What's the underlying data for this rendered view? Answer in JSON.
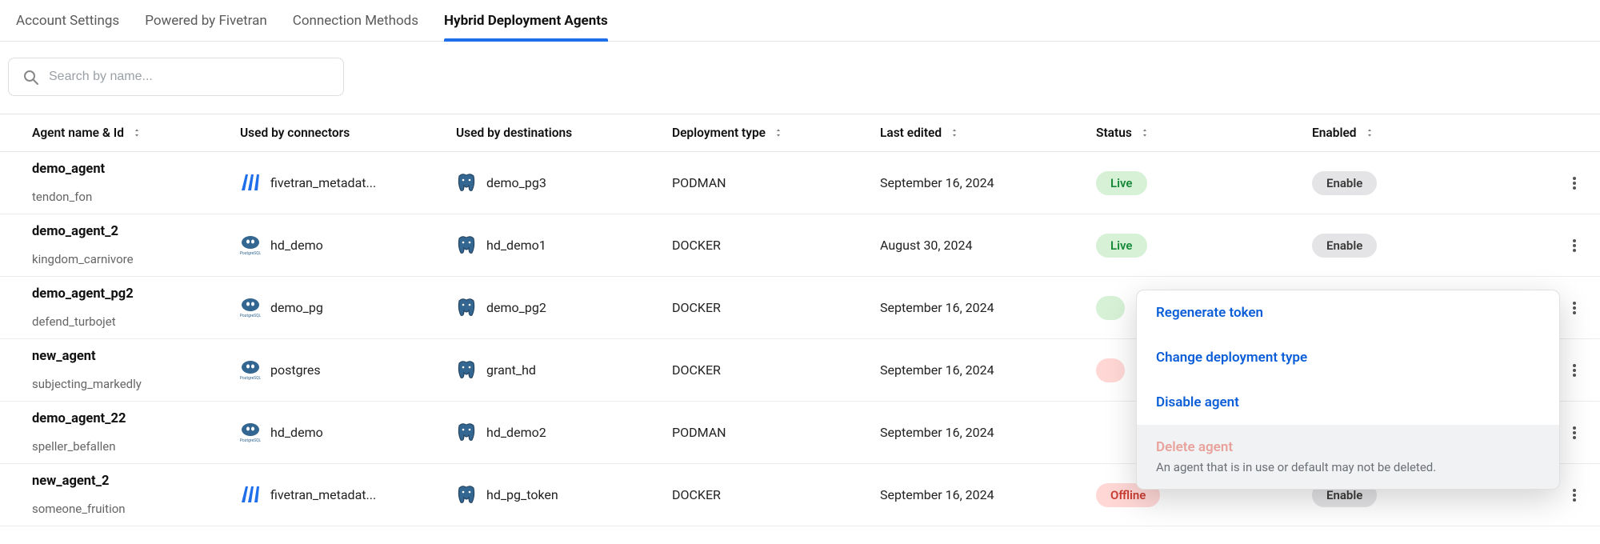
{
  "tabs": [
    {
      "label": "Account Settings",
      "active": false
    },
    {
      "label": "Powered by Fivetran",
      "active": false
    },
    {
      "label": "Connection Methods",
      "active": false
    },
    {
      "label": "Hybrid Deployment Agents",
      "active": true
    }
  ],
  "search": {
    "placeholder": "Search by name..."
  },
  "columns": {
    "agent": {
      "label": "Agent name & Id",
      "sortable": true
    },
    "conn": {
      "label": "Used by connectors",
      "sortable": false
    },
    "dest": {
      "label": "Used by destinations",
      "sortable": false
    },
    "deploy": {
      "label": "Deployment type",
      "sortable": true
    },
    "edited": {
      "label": "Last edited",
      "sortable": true
    },
    "status": {
      "label": "Status",
      "sortable": true
    },
    "enabled": {
      "label": "Enabled",
      "sortable": true
    }
  },
  "rows": [
    {
      "agent_name": "demo_agent",
      "agent_id": "tendon_fon",
      "connector_icon": "fivetran",
      "connector": "fivetran_metadat...",
      "destination_icon": "postgres-elephant",
      "destination": "demo_pg3",
      "deployment": "PODMAN",
      "last_edited": "September 16, 2024",
      "status": "Live",
      "status_kind": "live",
      "enabled": "Enable"
    },
    {
      "agent_name": "demo_agent_2",
      "agent_id": "kingdom_carnivore",
      "connector_icon": "postgres-logo",
      "connector": "hd_demo",
      "destination_icon": "postgres-elephant",
      "destination": "hd_demo1",
      "deployment": "DOCKER",
      "last_edited": "August 30, 2024",
      "status": "Live",
      "status_kind": "live",
      "enabled": "Enable"
    },
    {
      "agent_name": "demo_agent_pg2",
      "agent_id": "defend_turbojet",
      "connector_icon": "postgres-logo",
      "connector": "demo_pg",
      "destination_icon": "postgres-elephant",
      "destination": "demo_pg2",
      "deployment": "DOCKER",
      "last_edited": "September 16, 2024",
      "status": "",
      "status_kind": "live",
      "enabled": ""
    },
    {
      "agent_name": "new_agent",
      "agent_id": "subjecting_markedly",
      "connector_icon": "postgres-logo",
      "connector": "postgres",
      "destination_icon": "postgres-elephant",
      "destination": "grant_hd",
      "deployment": "DOCKER",
      "last_edited": "September 16, 2024",
      "status": "",
      "status_kind": "offline",
      "enabled": ""
    },
    {
      "agent_name": "demo_agent_22",
      "agent_id": "speller_befallen",
      "connector_icon": "postgres-logo",
      "connector": "hd_demo",
      "destination_icon": "postgres-elephant",
      "destination": "hd_demo2",
      "deployment": "PODMAN",
      "last_edited": "September 16, 2024",
      "status": "",
      "status_kind": "",
      "enabled": ""
    },
    {
      "agent_name": "new_agent_2",
      "agent_id": "someone_fruition",
      "connector_icon": "fivetran",
      "connector": "fivetran_metadat...",
      "destination_icon": "postgres-elephant",
      "destination": "hd_pg_token",
      "deployment": "DOCKER",
      "last_edited": "September 16, 2024",
      "status": "Offline",
      "status_kind": "offline",
      "enabled": "Enable"
    }
  ],
  "menu": {
    "items": [
      {
        "label": "Regenerate token",
        "disabled": false
      },
      {
        "label": "Change deployment type",
        "disabled": false
      },
      {
        "label": "Disable agent",
        "disabled": false
      },
      {
        "label": "Delete agent",
        "disabled": true,
        "sub": "An agent that is in use or default may not be deleted."
      }
    ]
  }
}
